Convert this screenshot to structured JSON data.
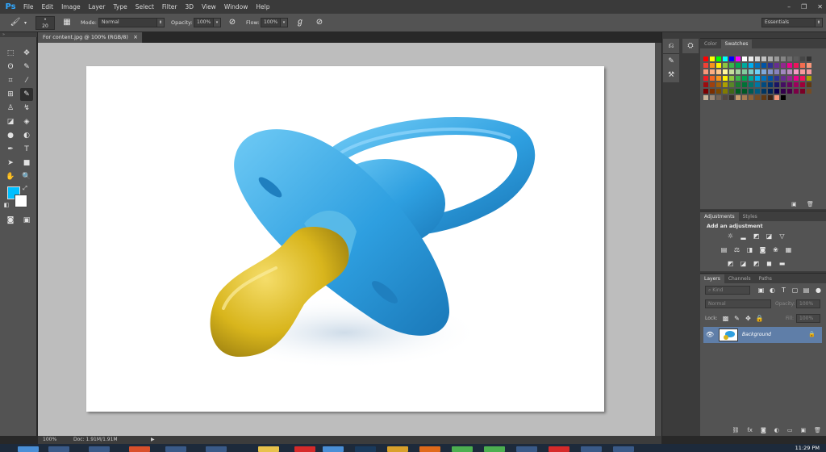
{
  "app": {
    "logo": "Ps"
  },
  "menu": [
    "File",
    "Edit",
    "Image",
    "Layer",
    "Type",
    "Select",
    "Filter",
    "3D",
    "View",
    "Window",
    "Help"
  ],
  "options": {
    "brush_size": "20",
    "mode_label": "Mode:",
    "mode_value": "Normal",
    "opacity_label": "Opacity:",
    "opacity_value": "100%",
    "flow_label": "Flow:",
    "flow_value": "100%",
    "workspace": "Essentials"
  },
  "document": {
    "tab_title": "For content.jpg @ 100% (RGB/8)",
    "close": "×",
    "zoom": "100%",
    "doc_info": "Doc: 1.91M/1.91M"
  },
  "colors": {
    "foreground": "#00bfff",
    "background": "#ffffff",
    "accent": "#31a8ff"
  },
  "panels": {
    "color_tab": "Color",
    "swatches_tab": "Swatches",
    "adjustments_tab": "Adjustments",
    "styles_tab": "Styles",
    "add_adjustment": "Add an adjustment",
    "layers_tab": "Layers",
    "channels_tab": "Channels",
    "paths_tab": "Paths",
    "kind_filter": "Kind",
    "blend_mode": "Normal",
    "opacity_label": "Opacity:",
    "opacity_value": "100%",
    "lock_label": "Lock:",
    "fill_label": "Fill:",
    "fill_value": "100%",
    "layer_name": "Background"
  },
  "taskbar": {
    "clock": "11:29 PM"
  }
}
